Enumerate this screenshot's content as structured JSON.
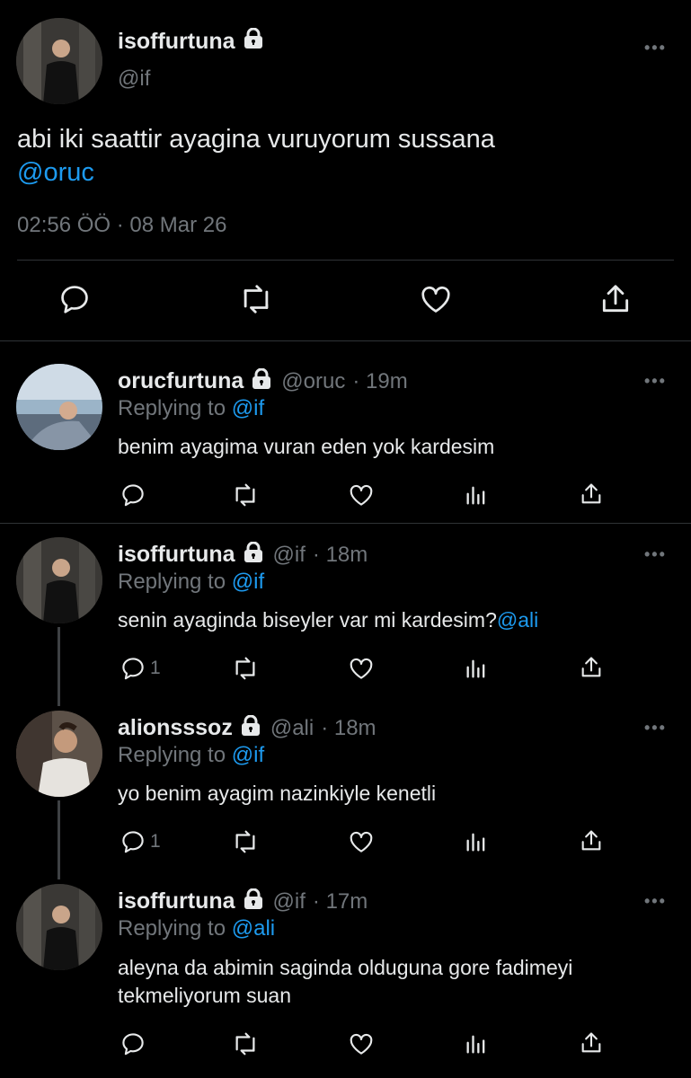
{
  "main_tweet": {
    "name": "isoffurtuna",
    "handle": "@if",
    "text_plain": "abi iki saattir ayagina vuruyorum sussana ",
    "text_mention": "@oruc",
    "timestamp": "02:56 ÖÖ · 08 Mar 26"
  },
  "more_icon": "•••",
  "replies": [
    {
      "name": "orucfurtuna",
      "handle": "@oruc",
      "time": "· 19m",
      "replying_label": "Replying to ",
      "replying_to": "@if",
      "text": "benim ayagima vuran eden yok kardesim",
      "reply_count": ""
    },
    {
      "name": "isoffurtuna",
      "handle": "@if",
      "time": "· 18m",
      "replying_label": "Replying to ",
      "replying_to": "@if",
      "text": "senin ayaginda biseyler var mi kardesim?",
      "text_mention": "@ali",
      "reply_count": "1"
    },
    {
      "name": "alionsssoz",
      "handle": "@ali",
      "time": "· 18m",
      "replying_label": "Replying to ",
      "replying_to": "@if",
      "text": "yo benim ayagim nazinkiyle kenetli",
      "reply_count": "1"
    },
    {
      "name": "isoffurtuna",
      "handle": "@if",
      "time": "· 17m",
      "replying_label": "Replying to ",
      "replying_to": "@ali",
      "text_line1": "aleyna da abimin saginda olduguna gore fadimeyi",
      "text_line2": "tekmeliyorum suan",
      "reply_count": ""
    }
  ],
  "colors": {
    "background": "#000000",
    "text": "#e7e9ea",
    "muted": "#71767b",
    "link": "#1d9bf0"
  }
}
